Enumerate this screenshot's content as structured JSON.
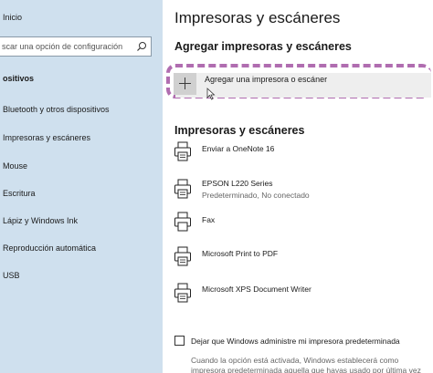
{
  "sidebar": {
    "home_label": "Inicio",
    "search_placeholder": "scar una opción de configuración",
    "section_label": "ositivos",
    "items": [
      {
        "label": "Bluetooth y otros dispositivos"
      },
      {
        "label": "Impresoras y escáneres"
      },
      {
        "label": "Mouse"
      },
      {
        "label": "Escritura"
      },
      {
        "label": "Lápiz y Windows Ink"
      },
      {
        "label": "Reproducción automática"
      },
      {
        "label": "USB"
      }
    ]
  },
  "main": {
    "title": "Impresoras y escáneres",
    "add_section_title": "Agregar impresoras y escáneres",
    "add_button_label": "Agregar una impresora o escáner",
    "printers_section_title": "Impresoras y escáneres",
    "printers": [
      {
        "name": "Enviar a OneNote 16",
        "status": ""
      },
      {
        "name": "EPSON L220 Series",
        "status": "Predeterminado, No conectado"
      },
      {
        "name": "Fax",
        "status": ""
      },
      {
        "name": "Microsoft Print to PDF",
        "status": ""
      },
      {
        "name": "Microsoft XPS Document Writer",
        "status": ""
      }
    ],
    "default_checkbox_label": "Dejar que Windows administre mi impresora predeterminada",
    "footnote": "Cuando la opción está activada, Windows establecerá como impresora predeterminada aquella que hayas usado por última vez en la ubicación"
  },
  "colors": {
    "sidebar_bg": "#cfe0ee",
    "highlight_dash": "#b06db0"
  }
}
